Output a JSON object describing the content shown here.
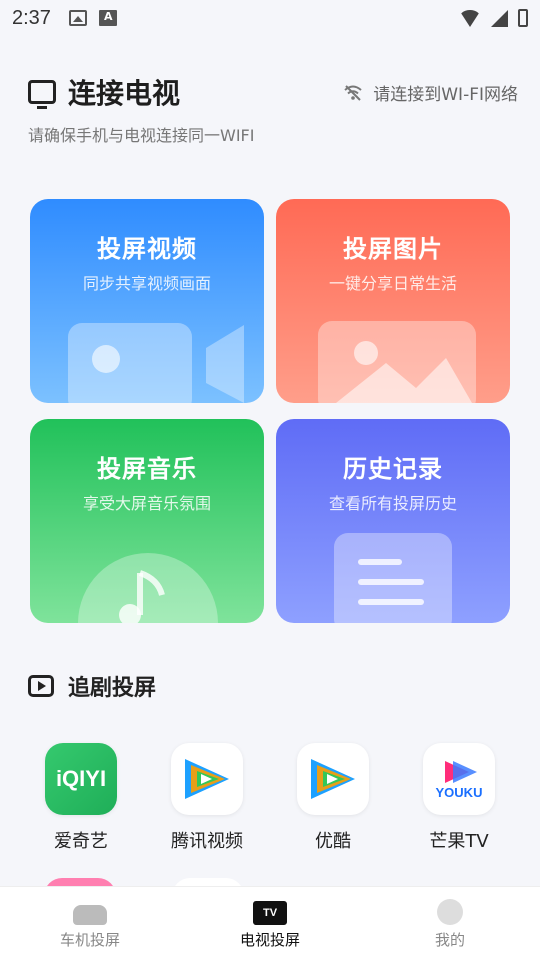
{
  "status": {
    "time": "2:37"
  },
  "header": {
    "title": "连接电视",
    "subtitle": "请确保手机与电视连接同一WIFI",
    "wifi_hint": "请连接到WI-FI网络"
  },
  "cards": [
    {
      "title": "投屏视频",
      "sub": "同步共享视频画面",
      "color": "#2f8cff"
    },
    {
      "title": "投屏图片",
      "sub": "一键分享日常生活",
      "color": "#ff6a55"
    },
    {
      "title": "投屏音乐",
      "sub": "享受大屏音乐氛围",
      "color": "#21c15a"
    },
    {
      "title": "历史记录",
      "sub": "查看所有投屏历史",
      "color": "#5f6cf6"
    }
  ],
  "section": {
    "title": "追剧投屏"
  },
  "apps": [
    {
      "label": "爱奇艺",
      "logo_text": "iQIYI"
    },
    {
      "label": "腾讯视频"
    },
    {
      "label": "优酷"
    },
    {
      "label": "芒果TV",
      "logo_text": "YOUKU"
    }
  ],
  "nav": [
    {
      "label": "车机投屏"
    },
    {
      "label": "电视投屏",
      "icon_text": "TV"
    },
    {
      "label": "我的"
    }
  ]
}
